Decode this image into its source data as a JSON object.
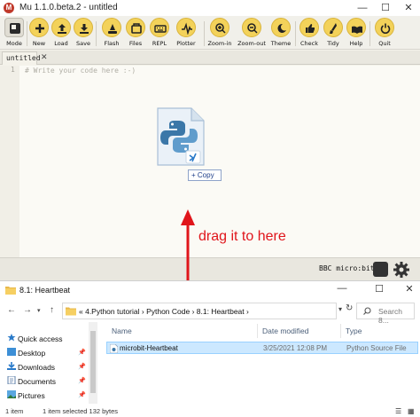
{
  "mu": {
    "title": "Mu 1.1.0.beta.2 - untitled",
    "logo_text": "M",
    "window_buttons": [
      "—",
      "☐",
      "✕"
    ],
    "toolbar": [
      {
        "id": "mode",
        "label": "Mode",
        "icon": "mode-icon"
      },
      {
        "id": "new",
        "label": "New",
        "icon": "plus-icon"
      },
      {
        "id": "load",
        "label": "Load",
        "icon": "upload-icon"
      },
      {
        "id": "save",
        "label": "Save",
        "icon": "download-icon"
      },
      {
        "id": "flash",
        "label": "Flash",
        "icon": "flash-icon"
      },
      {
        "id": "files",
        "label": "Files",
        "icon": "files-icon"
      },
      {
        "id": "repl",
        "label": "REPL",
        "icon": "keyboard-icon"
      },
      {
        "id": "plotter",
        "label": "Plotter",
        "icon": "plotter-icon"
      },
      {
        "id": "zoomin",
        "label": "Zoom-in",
        "icon": "zoom-in-icon"
      },
      {
        "id": "zoomout",
        "label": "Zoom-out",
        "icon": "zoom-out-icon"
      },
      {
        "id": "theme",
        "label": "Theme",
        "icon": "theme-icon"
      },
      {
        "id": "check",
        "label": "Check",
        "icon": "thumbs-up-icon"
      },
      {
        "id": "tidy",
        "label": "Tidy",
        "icon": "tidy-icon"
      },
      {
        "id": "help",
        "label": "Help",
        "icon": "help-icon"
      },
      {
        "id": "quit",
        "label": "Quit",
        "icon": "power-icon"
      }
    ],
    "tab": {
      "label": "untitled",
      "close": "✕"
    },
    "editor": {
      "line_number": "1",
      "code": "# Write your code here :-)"
    },
    "status": {
      "mode": "BBC micro:bit"
    },
    "accent": "#f3d25a"
  },
  "drag": {
    "copy_label": "+ Copy",
    "annotation": "drag it to here",
    "annotation_color": "#e0151b"
  },
  "explorer": {
    "title": "8.1:  Heartbeat",
    "window_buttons": [
      "—",
      "☐",
      "✕"
    ],
    "nav": {
      "back": "←",
      "forward": "→",
      "up": "↑"
    },
    "breadcrumb": "«  4.Python tutorial  ›  Python Code  ›  8.1:  Heartbeat  ›",
    "search_placeholder": "Search 8...",
    "sidebar": [
      {
        "label": "Quick access",
        "pinned": false
      },
      {
        "label": "Desktop",
        "pinned": true
      },
      {
        "label": "Downloads",
        "pinned": true
      },
      {
        "label": "Documents",
        "pinned": true
      },
      {
        "label": "Pictures",
        "pinned": true
      }
    ],
    "columns": [
      "Name",
      "Date modified",
      "Type"
    ],
    "rows": [
      {
        "name": "microbit-Heartbeat",
        "date": "3/25/2021 12:08 PM",
        "type": "Python Source File"
      }
    ],
    "status": {
      "items": "1 item",
      "selected": "1 item selected  132 bytes"
    }
  }
}
